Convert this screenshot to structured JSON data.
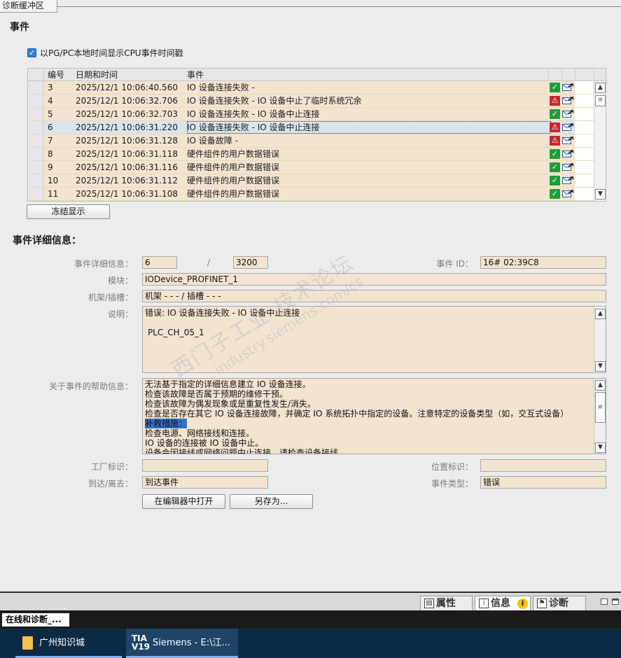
{
  "panel": {
    "tab_title": "诊断缓冲区",
    "events_heading": "事件",
    "checkbox_label": "以PG/PC本地时间显示CPU事件时间戳",
    "freeze_button": "冻结显示",
    "details_heading": "事件详细信息："
  },
  "table": {
    "headers": {
      "num": "编号",
      "datetime": "日期和时间",
      "event": "事件"
    },
    "rows": [
      {
        "num": "3",
        "datetime": "2025/12/1 10:06:40.560",
        "event": "IO 设备连接失败 -",
        "status": "ok"
      },
      {
        "num": "4",
        "datetime": "2025/12/1 10:06:32.706",
        "event": "IO 设备连接失败 - IO 设备中止了临时系统冗余",
        "status": "err"
      },
      {
        "num": "5",
        "datetime": "2025/12/1 10:06:32.703",
        "event": "IO 设备连接失败 - IO 设备中止连接",
        "status": "ok"
      },
      {
        "num": "6",
        "datetime": "2025/12/1 10:06:31.220",
        "event": "IO 设备连接失败 - IO 设备中止连接",
        "status": "err"
      },
      {
        "num": "7",
        "datetime": "2025/12/1 10:06:31.128",
        "event": "IO 设备故障 -",
        "status": "err"
      },
      {
        "num": "8",
        "datetime": "2025/12/1 10:06:31.118",
        "event": "硬件组件的用户数据错误",
        "status": "ok"
      },
      {
        "num": "9",
        "datetime": "2025/12/1 10:06:31.116",
        "event": "硬件组件的用户数据错误",
        "status": "ok"
      },
      {
        "num": "10",
        "datetime": "2025/12/1 10:06:31.112",
        "event": "硬件组件的用户数据错误",
        "status": "ok"
      },
      {
        "num": "11",
        "datetime": "2025/12/1 10:06:31.108",
        "event": "硬件组件的用户数据错误",
        "status": "ok"
      }
    ]
  },
  "details": {
    "detail_label": "事件详细信息：",
    "detail_index": "6",
    "detail_sep": "/",
    "detail_total": "3200",
    "event_id_label": "事件 ID：",
    "event_id": "16# 02:39C8",
    "module_label": "模块：",
    "module": "IODevice_PROFINET_1",
    "rack_label": "机架/插槽：",
    "rack": "机架 - - - / 插槽 - - -",
    "desc_label": "说明：",
    "desc_line1": "错误: IO 设备连接失败 - IO 设备中止连接",
    "desc_line2": "PLC_CH_05_1",
    "help_label": "关于事件的帮助信息：",
    "help_lines": [
      "无法基于指定的详细信息建立 IO 设备连接。",
      "检查该故障是否属于预期的维修干预。",
      "检查该故障为偶发现象或是重复性发生/消失。",
      "检查是否存在其它 IO 设备连接故障，并确定 IO 系统拓扑中指定的设备。注意特定的设备类型（如，交互式设备）",
      "补救措施：",
      "检查电源、网络接线和连接。",
      " IO 设备的连接被 IO 设备中止。",
      "设备会因接线或网络问题中止连接。请检查设备接线。"
    ],
    "plant_label": "工厂标识：",
    "plant": "",
    "location_label": "位置标识：",
    "location": "",
    "arrive_label": "到达/离去：",
    "arrive": "到达事件",
    "type_label": "事件类型：",
    "type": "错误",
    "open_editor_button": "在编辑器中打开",
    "save_as_button": "另存为..."
  },
  "watermark": {
    "line1": "西门子工业 技术论坛",
    "line2": "industry.siemens.com/cs"
  },
  "inspector_tabs": {
    "properties": "属性",
    "info": "信息",
    "diagnostics": "诊断"
  },
  "portal_tab": "在线和诊断_...",
  "taskbar": {
    "item1": "广州知识城",
    "item2": "Siemens  -  E:\\江...",
    "tia_icon": "TIA V19"
  },
  "colors": {
    "field_bg": "#f3e4cf",
    "ok": "#1f9c3a",
    "err": "#c62828",
    "taskbar": "#0d2a44"
  }
}
